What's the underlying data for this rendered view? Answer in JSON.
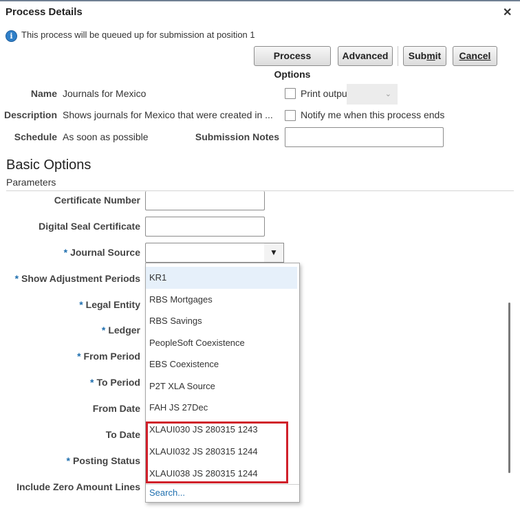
{
  "dialog": {
    "title": "Process Details"
  },
  "info": {
    "message": "This process will be queued up for submission at position 1"
  },
  "buttons": {
    "process_options": "Process Options",
    "advanced": "Advanced",
    "submit": "Submit",
    "cancel": "Cancel"
  },
  "details": {
    "name_label": "Name",
    "name_value": "Journals for Mexico",
    "description_label": "Description",
    "description_value": "Shows journals for Mexico that were created in ...",
    "schedule_label": "Schedule",
    "schedule_value": "As soon as possible",
    "print_output_label": "Print output",
    "notify_label": "Notify me when this process ends",
    "submission_notes_label": "Submission Notes",
    "submission_notes_value": ""
  },
  "basic_options": {
    "heading": "Basic Options",
    "subheading": "Parameters",
    "fields": [
      {
        "label": "Certificate Number",
        "required": false
      },
      {
        "label": "Digital Seal Certificate",
        "required": false
      },
      {
        "label": "Journal Source",
        "required": true
      },
      {
        "label": "Show Adjustment Periods",
        "required": true
      },
      {
        "label": "Legal Entity",
        "required": true
      },
      {
        "label": "Ledger",
        "required": true
      },
      {
        "label": "From Period",
        "required": true
      },
      {
        "label": "To Period",
        "required": true
      },
      {
        "label": "From Date",
        "required": false
      },
      {
        "label": "To Date",
        "required": false
      },
      {
        "label": "Posting Status",
        "required": true
      },
      {
        "label": "Include Zero Amount Lines",
        "required": false
      }
    ],
    "required_marker": "*"
  },
  "journal_source_dropdown": {
    "options": [
      "KR1",
      "RBS Mortgages",
      "RBS Savings",
      "PeopleSoft Coexistence",
      "EBS Coexistence",
      "P2T XLA Source",
      "FAH JS 27Dec",
      "XLAUI030 JS 280315 1243",
      "XLAUI032 JS 280315 1244",
      "XLAUI038 JS 280315 1244"
    ],
    "highlighted_index": 0,
    "search_link": "Search..."
  },
  "colors": {
    "accent": "#1f6faf",
    "highlight_box": "#d01f2a",
    "option_highlight": "#e6f0fa"
  }
}
